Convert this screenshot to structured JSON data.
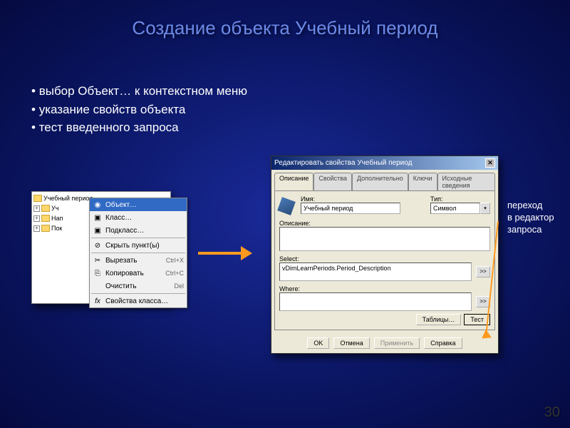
{
  "slide": {
    "title": "Создание объекта Учебный период",
    "number": "30"
  },
  "bullets": {
    "b1": "выбор Объект… к контекстном меню",
    "b2": "указание свойств объекта",
    "b3": "тест введенного запроса"
  },
  "tree": {
    "item1": "Учебный период",
    "item2": "Уч",
    "item3": "Нап",
    "item4": "Пок"
  },
  "context_menu": {
    "object": "Объект…",
    "class": "Класс…",
    "subclass": "Подкласс…",
    "hide": "Скрыть пункт(ы)",
    "cut": "Вырезать",
    "cut_sc": "Ctrl+X",
    "copy": "Копировать",
    "copy_sc": "Ctrl+C",
    "clear": "Очистить",
    "clear_sc": "Del",
    "props": "Свойства класса…"
  },
  "dialog": {
    "title": "Редактировать свойства Учебный период",
    "tabs": {
      "desc": "Описание",
      "props": "Свойства",
      "extra": "Дополнительно",
      "keys": "Ключи",
      "source": "Исходные сведения"
    },
    "name_label": "Имя:",
    "name_value": "Учебный период",
    "type_label": "Тип:",
    "type_value": "Символ",
    "desc_label": "Описание:",
    "desc_value": "",
    "select_label": "Select:",
    "select_value": "vDimLearnPeriods.Period_Description",
    "where_label": "Where:",
    "where_value": "",
    "tables_btn": "Таблицы…",
    "test_btn": "Тест",
    "ok": "OK",
    "cancel": "Отмена",
    "apply": "Применить",
    "help": "Справка",
    "side_btn": ">>"
  },
  "annotation": {
    "l1": "переход",
    "l2": "в редактор",
    "l3": "запроса"
  }
}
